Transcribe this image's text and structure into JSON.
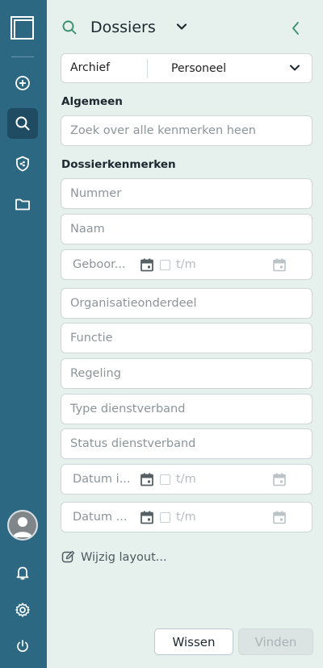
{
  "rail": {
    "items": [
      {
        "icon": "plus-circle-icon",
        "active": false
      },
      {
        "icon": "search-icon",
        "active": true
      },
      {
        "icon": "shield-icon",
        "active": false
      },
      {
        "icon": "folder-icon",
        "active": false
      }
    ],
    "bottom": [
      "bell-icon",
      "gear-icon",
      "power-icon"
    ]
  },
  "header": {
    "title": "Dossiers"
  },
  "archive": {
    "label": "Archief",
    "selected": "Personeel"
  },
  "sections": {
    "general": "Algemeen",
    "properties": "Dossierkenmerken"
  },
  "fields": {
    "general_search": "Zoek over alle kenmerken heen",
    "nummer": "Nummer",
    "naam": "Naam",
    "geboortedatum": "Geboor...",
    "organisatieonderdeel": "Organisatieonderdeel",
    "functie": "Functie",
    "regeling": "Regeling",
    "type_dienstverband": "Type dienstverband",
    "status_dienstverband": "Status dienstverband",
    "datum_in": "Datum i...",
    "datum_uit": "Datum ...",
    "range_to": "t/m"
  },
  "footer": {
    "change_layout": "Wijzig layout...",
    "clear": "Wissen",
    "find": "Vinden"
  },
  "colors": {
    "rail": "#2d6883",
    "accent": "#3a8f6e",
    "panel": "#e6f0ec"
  }
}
